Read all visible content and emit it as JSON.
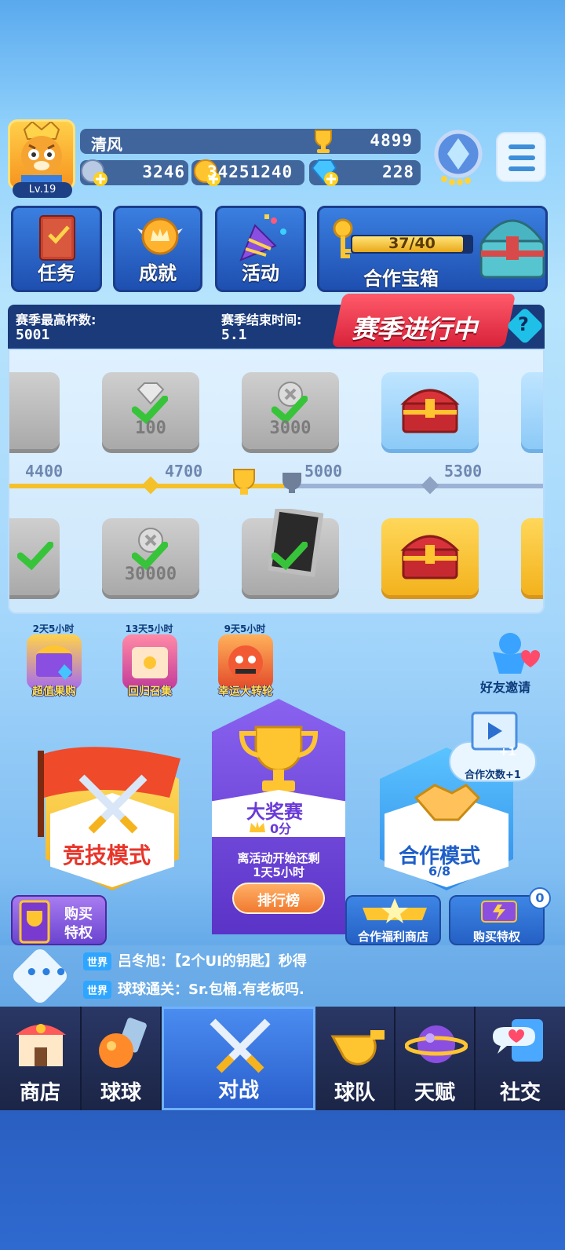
{
  "player": {
    "name": "清风",
    "level": "Lv.19",
    "trophies": "4899",
    "stamina": "3246",
    "coins": "34251240",
    "gems": "228"
  },
  "quick": {
    "tasks": "任务",
    "achievements": "成就",
    "activity": "活动",
    "coop_chest_label": "合作宝箱",
    "coop_chest_progress": "37/40"
  },
  "season": {
    "max_cups_label": "赛季最高杯数:",
    "max_cups_value": "5001",
    "end_label": "赛季结束时间:",
    "end_value": "5.1",
    "status": "赛季进行中",
    "help": "?",
    "top_row": [
      "100",
      "3000"
    ],
    "milestones": [
      "4400",
      "4700",
      "5000",
      "5300"
    ],
    "bottom_row": [
      "30000"
    ]
  },
  "events": [
    {
      "timer": "2天5小时",
      "name": "超值果购"
    },
    {
      "timer": "13天5小时",
      "name": "回归召集"
    },
    {
      "timer": "9天5小时",
      "name": "幸运大转轮"
    }
  ],
  "friend_invite": "好友邀请",
  "modes": {
    "compete": "竞技模式",
    "grand_prix": {
      "title": "大奖赛",
      "score": "0分",
      "countdown": "离活动开始还剩",
      "countdown2": "1天5小时",
      "rank": "排行榜"
    },
    "coop": {
      "title": "合作模式",
      "progress": "6/8",
      "bubble": "合作次数+1",
      "video_plus": "+1"
    }
  },
  "buttons": {
    "buy_priv_1a": "购买",
    "buy_priv_1b": "特权",
    "coop_shop": "合作福利商店",
    "buy_priv_2": "购买特权",
    "badge": "0"
  },
  "chat": [
    {
      "tag": "世界",
      "text": "吕冬旭：【2个UI的钥匙】秒得"
    },
    {
      "tag": "世界",
      "text": "球球通关：Sr.包桶.有老板吗."
    }
  ],
  "nav": [
    "商店",
    "球球",
    "对战",
    "球队",
    "天赋",
    "社交"
  ],
  "colors": {
    "accent": "#2a5fcc",
    "gold": "#f3b21d",
    "nav_bg": "#1f2a4e"
  }
}
